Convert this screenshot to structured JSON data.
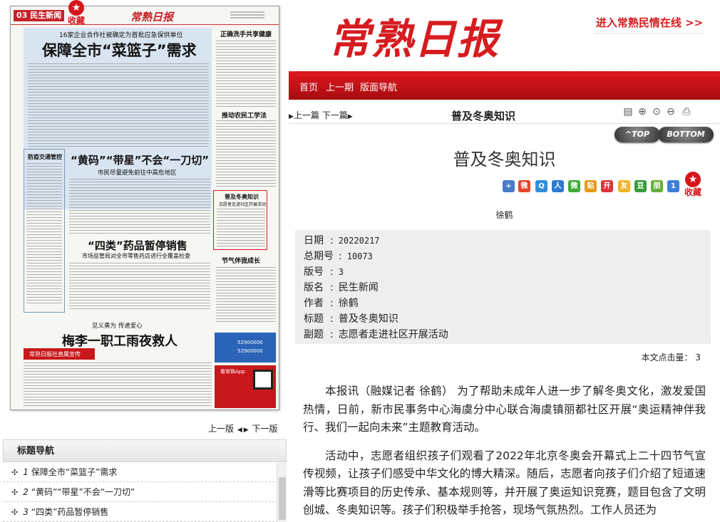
{
  "newspaper": {
    "page_label": "03 民生新闻",
    "logo": "常熟日报",
    "headline_kicker": "16家企业合作社被确定为首批应急保供单位",
    "headline": "保障全市“菜篮子”需求",
    "side1_title": "正确洗手共享健康",
    "side2_title": "推动农民工学法",
    "left_box_title": "防疫交通管控",
    "headline2": "“黄码”“带星”不会“一刀切”",
    "sub2": "市民尽量避免前往中高危地区",
    "highlight_title": "普及冬奥知识",
    "highlight_sub": "志愿者走进社区开展活动",
    "headline3": "“四类”药品暂停销售",
    "sub3": "市场监管局对全市零售药店进行全覆盖检查",
    "side3_title": "节气伴我成长",
    "kicker4": "见义勇为 传递爱心",
    "headline4": "梅李一职工雨夜救人",
    "red_banner": "常熟日报社直属宣传",
    "ad_text1": "52900000",
    "ad_text2": "52900000",
    "app_label": "看常熟App"
  },
  "collect_label": "收藏",
  "pager": {
    "prev": "上一版",
    "next": "下一版"
  },
  "toc": {
    "title": "标题导航",
    "items": [
      {
        "num": "1",
        "label": "保障全市“菜篮子”需求"
      },
      {
        "num": "2",
        "label": "“黄码”“带星”不会“一刀切”"
      },
      {
        "num": "3",
        "label": "“四类”药品暂停销售"
      }
    ]
  },
  "banner": {
    "masthead": "常熟日报",
    "link": "进入常熟民情在线 >>"
  },
  "nav": {
    "home": "首页",
    "prev_issue": "上一期",
    "page_nav": "版面导航"
  },
  "titlebar": {
    "prev": "上一篇",
    "next": "下一篇",
    "title": "普及冬奥知识"
  },
  "buttons": {
    "top": "^TOP",
    "bottom": "BOTTOM"
  },
  "article": {
    "title": "普及冬奥知识",
    "author_line": "徐鹤",
    "meta": {
      "date_label": "日期",
      "date": "20220217",
      "issue_label": "总期号",
      "issue": "10073",
      "page_label": "版号",
      "page": "3",
      "section_label": "版名",
      "section": "民生新闻",
      "author_label": "作者",
      "author": "徐鹤",
      "title_label": "标题",
      "title": "普及冬奥知识",
      "subtitle_label": "副题",
      "subtitle": "志愿者走进社区开展活动"
    },
    "hits_label": "本文点击量：",
    "hits": "3",
    "paragraphs": [
      "本报讯（融媒记者 徐鹤） 为了帮助未成年人进一步了解冬奥文化，激发爱国热情，日前，新市民事务中心海虞分中心联合海虞镇丽都社区开展“奥运精神伴我行、我们一起向未来”主题教育活动。",
      "活动中，志愿者组织孩子们观看了2022年北京冬奥会开幕式上二十四节气宣传视频，让孩子们感受中华文化的博大精深。随后，志愿者向孩子们介绍了短道速滑等比赛项目的历史传承、基本规则等，并开展了奥运知识竞赛，题目包含了文明创城、冬奥知识等。孩子们积极举手抢答，现场气氛热烈。工作人员还为"
    ]
  },
  "share_icons": [
    "plus-share-icon",
    "weibo-icon",
    "qzone-icon",
    "renren-icon",
    "wechat-icon",
    "tieba-icon",
    "kaixin-icon",
    "qq-friend-icon",
    "douban-icon",
    "pengyou-icon",
    "counter-icon"
  ],
  "colors": {
    "brand_red": "#d61c20",
    "nav_red": "#c6171c"
  }
}
